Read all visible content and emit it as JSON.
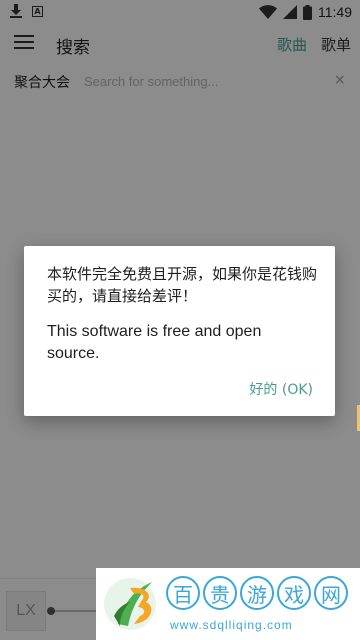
{
  "status_bar": {
    "time": "11:49",
    "left_icons": [
      "download-icon",
      "a-notification-icon"
    ],
    "right_icons": [
      "wifi-icon",
      "signal-icon",
      "battery-icon"
    ]
  },
  "app_bar": {
    "menu_icon": "menu-icon",
    "title": "搜索",
    "tabs": [
      {
        "label": "歌曲",
        "active": true
      },
      {
        "label": "歌单",
        "active": false
      }
    ]
  },
  "search": {
    "source_label": "聚合大会",
    "placeholder": "Search for something...",
    "value": "",
    "clear_icon": "×"
  },
  "player": {
    "logo_text": "LX"
  },
  "dialog": {
    "message_zh": "本软件完全免费且开源，如果你是花钱购买的，请直接给差评！",
    "message_en": "This software is free and open source.",
    "ok_label": "好的 (OK)"
  },
  "watermark": {
    "title_chars": [
      "百",
      "贵",
      "游",
      "戏",
      "网"
    ],
    "url": "www.sdqlliqing.com"
  },
  "colors": {
    "accent": "#4a9b8e",
    "scrim": "rgba(0,0,0,0.44)",
    "watermark": "#3aa7d8"
  }
}
